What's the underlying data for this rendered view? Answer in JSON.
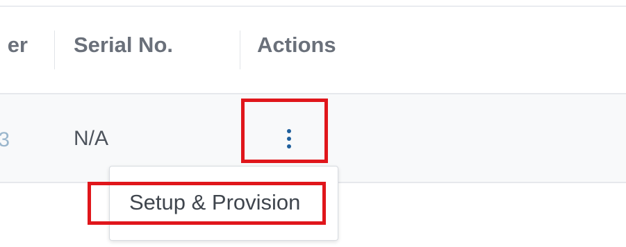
{
  "table": {
    "columns": [
      {
        "label": "Manufacturer",
        "visible_fragment": "er"
      },
      {
        "label": "Serial No."
      },
      {
        "label": "Actions"
      }
    ],
    "rows": [
      {
        "partial_cell": "3",
        "serial_no": "N/A",
        "actions_icon": "kebab-vertical-icon"
      }
    ]
  },
  "actions_menu": {
    "items": [
      {
        "label": "Setup & Provision"
      }
    ]
  },
  "colors": {
    "highlight": "#e0161b",
    "kebab": "#1f5f9c",
    "header_text": "#6a707a",
    "row_background": "#f8f9fa"
  }
}
